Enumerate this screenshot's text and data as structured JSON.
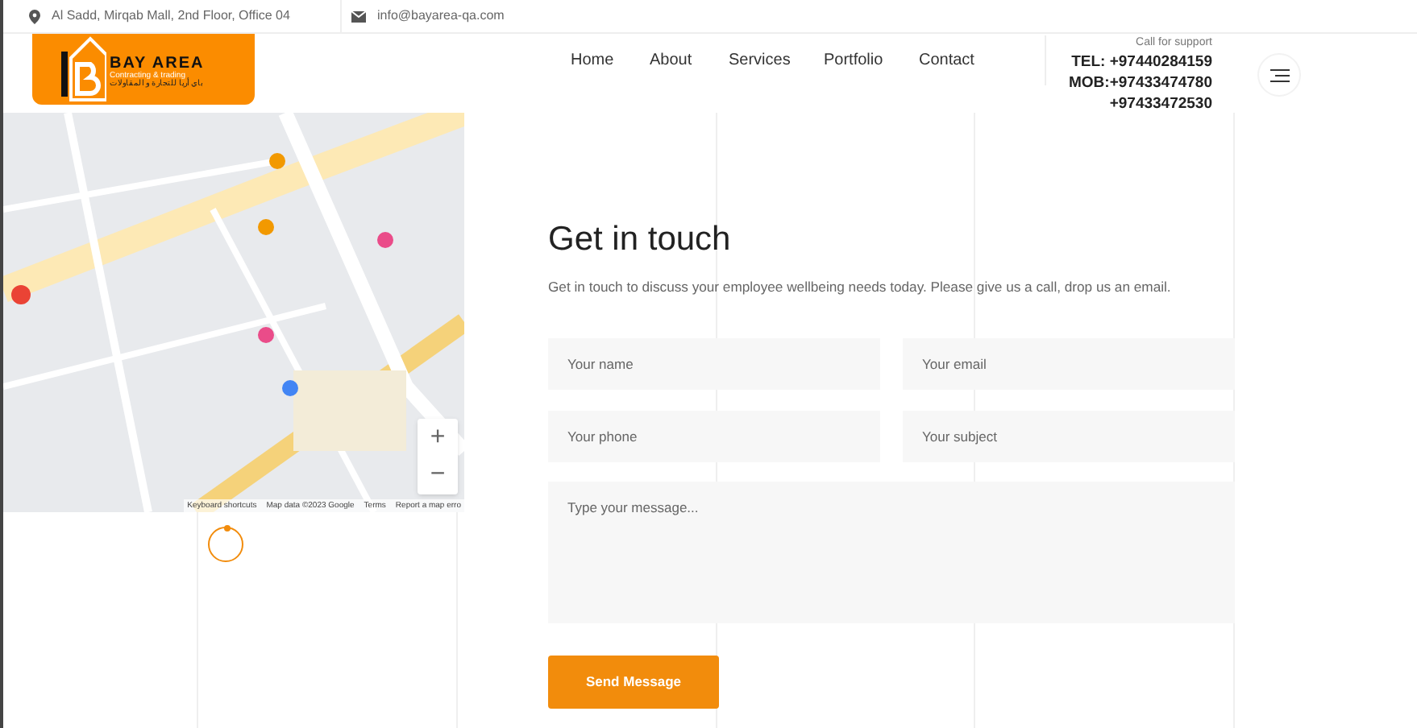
{
  "top_bar": {
    "address": "Al Sadd, Mirqab Mall, 2nd Floor, Office 04",
    "email": "info@bayarea-qa.com"
  },
  "logo": {
    "name": "BAY AREA",
    "tagline": "Contracting & trading",
    "arabic": "باي أريا للتجارة و المقاولات"
  },
  "nav": [
    {
      "label": "Home"
    },
    {
      "label": "About"
    },
    {
      "label": "Services"
    },
    {
      "label": "Portfolio"
    },
    {
      "label": "Contact"
    }
  ],
  "support": {
    "caption": "Call for support",
    "lines": [
      "TEL: +97440284159",
      "MOB:+97433474780",
      "+97433472530"
    ]
  },
  "map": {
    "attribution": [
      "Keyboard shortcuts",
      "Map data ©2023 Google",
      "Terms",
      "Report a map erro"
    ],
    "zoom_in": "+",
    "zoom_out": "−"
  },
  "contact": {
    "title": "Get in touch",
    "text": "Get in touch to discuss your employee wellbeing needs today. Please give us a call, drop us an email.",
    "fields": [
      {
        "placeholder": "Your name"
      },
      {
        "placeholder": "Your email"
      },
      {
        "placeholder": "Your phone"
      },
      {
        "placeholder": "Your subject"
      }
    ],
    "message": {
      "placeholder": "Type your message..."
    },
    "button": "Send Message"
  }
}
